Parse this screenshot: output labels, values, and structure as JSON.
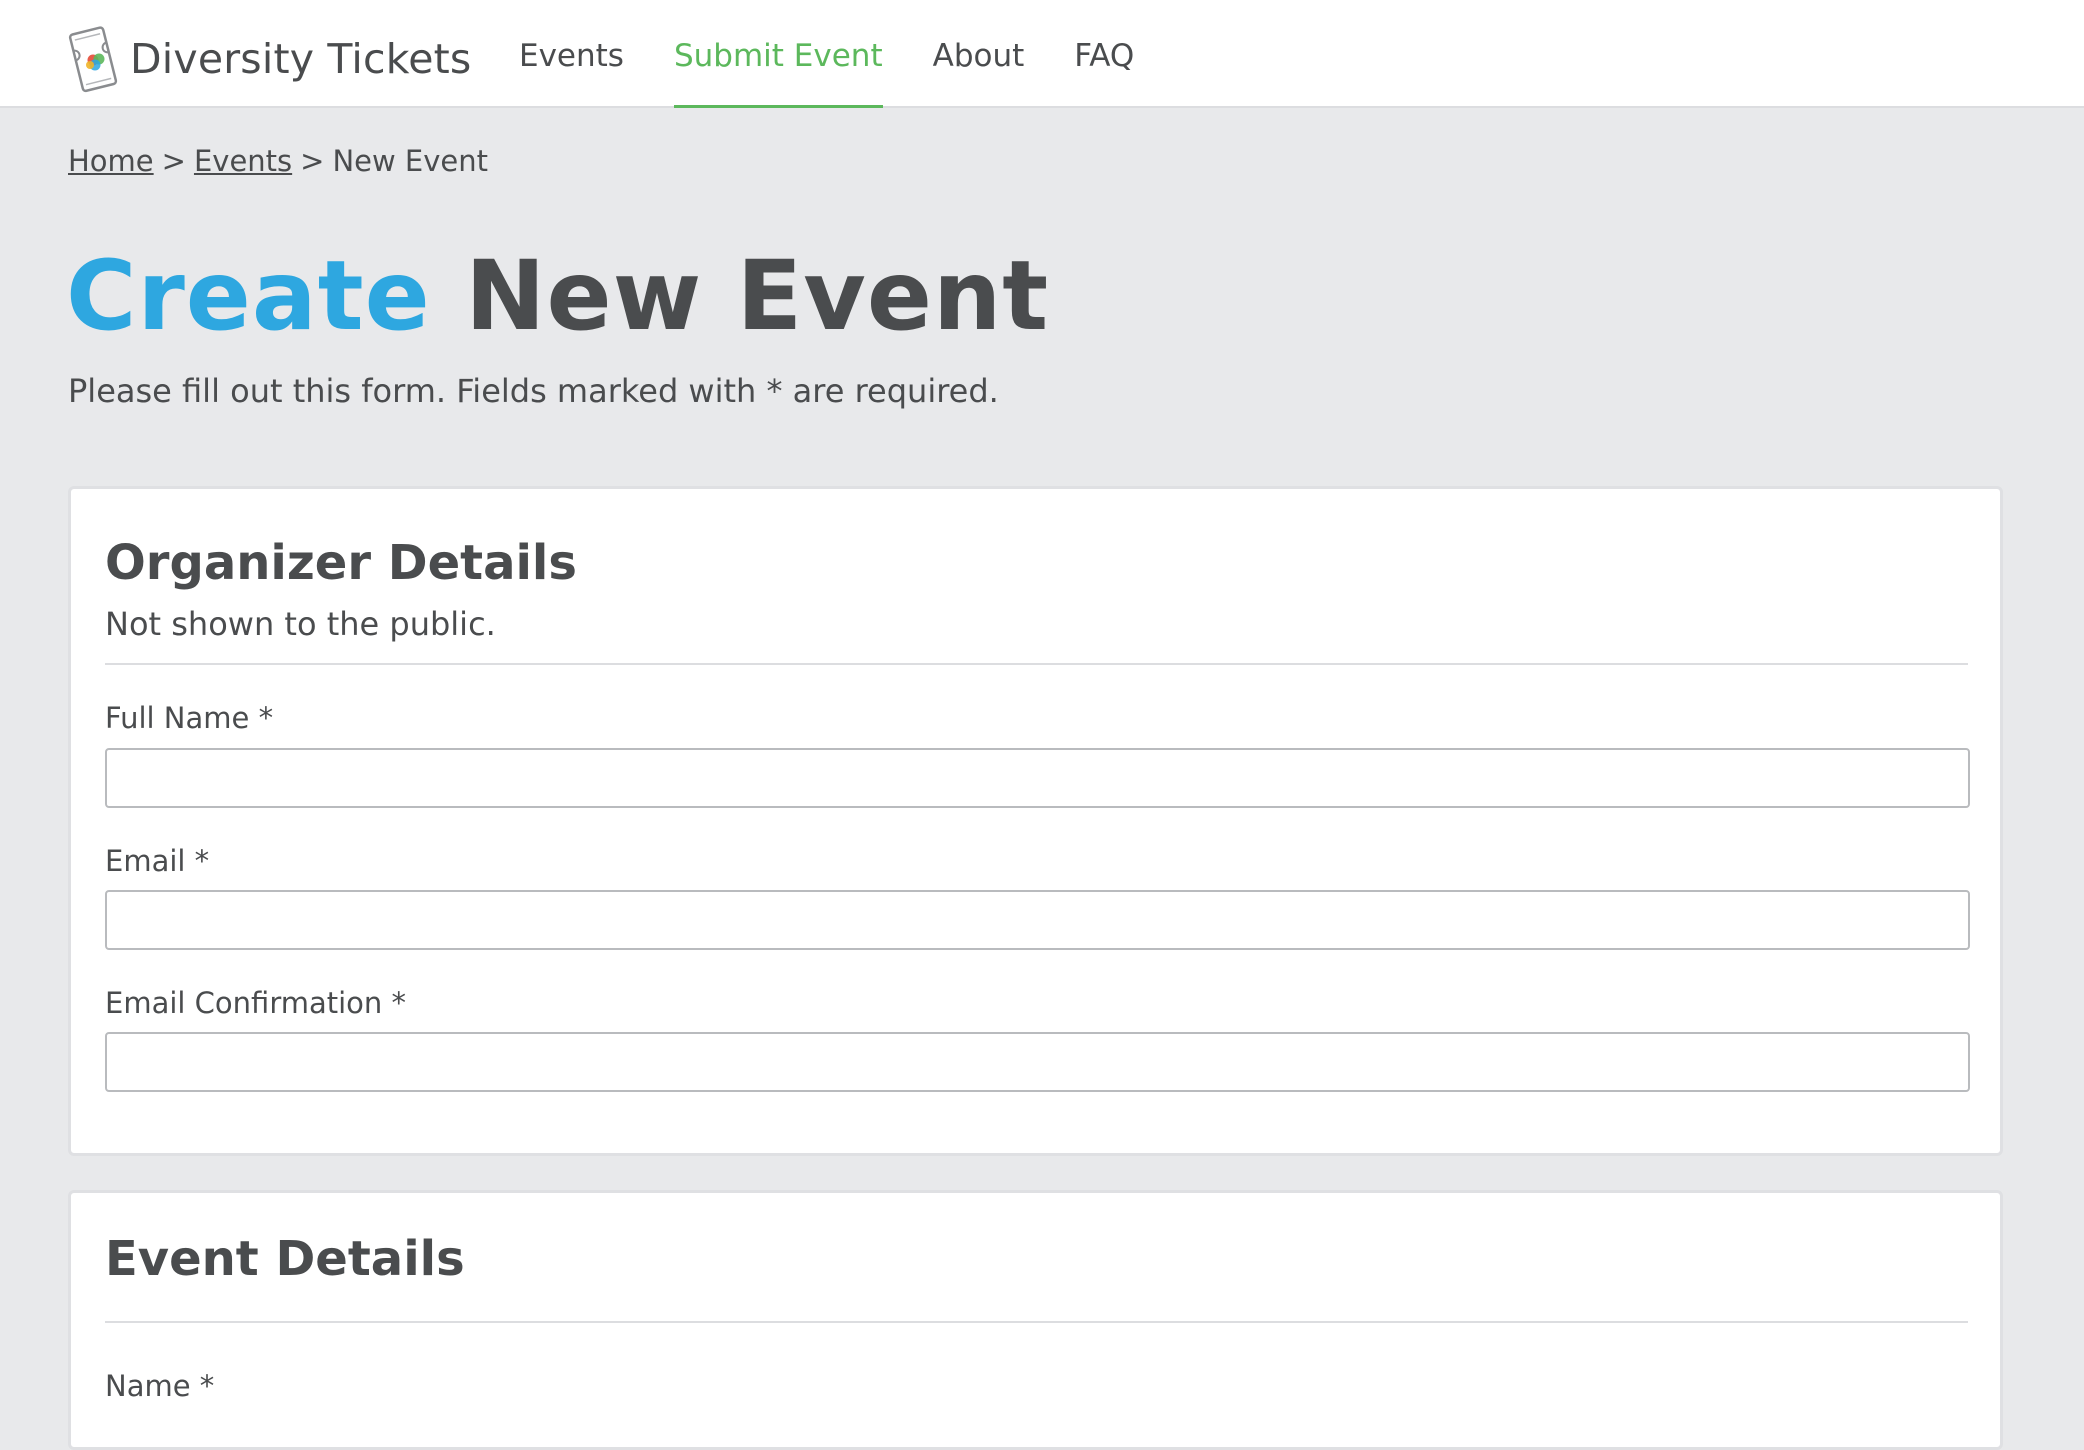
{
  "nav": {
    "brand": "Diversity Tickets",
    "links": [
      {
        "label": "Events",
        "active": false
      },
      {
        "label": "Submit Event",
        "active": true
      },
      {
        "label": "About",
        "active": false
      },
      {
        "label": "FAQ",
        "active": false
      }
    ]
  },
  "breadcrumb": {
    "home": "Home",
    "separator": ">",
    "events": "Events",
    "current": "New Event"
  },
  "page": {
    "title_accent": "Create",
    "title_rest": "New Event",
    "intro": "Please fill out this form. Fields marked with * are required."
  },
  "organizer": {
    "title": "Organizer Details",
    "subtitle": "Not shown to the public.",
    "fields": [
      {
        "label": "Full Name *",
        "value": ""
      },
      {
        "label": "Email *",
        "value": ""
      },
      {
        "label": "Email Confirmation *",
        "value": ""
      }
    ]
  },
  "event": {
    "title": "Event Details",
    "fields": [
      {
        "label": "Name *",
        "value": ""
      }
    ]
  },
  "colors": {
    "accent_blue": "#2ea7e0",
    "active_green": "#5cb85c",
    "text": "#4a4c4e",
    "background": "#e8e9eb"
  },
  "icons": {
    "brand_logo": "ticket-icon"
  }
}
